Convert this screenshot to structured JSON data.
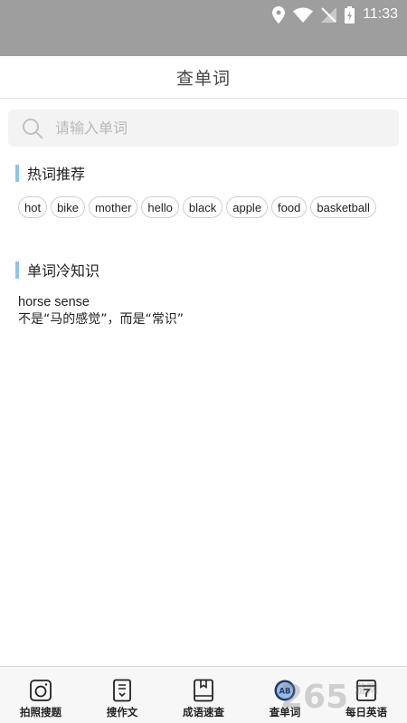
{
  "status_bar": {
    "time": "11:33"
  },
  "header": {
    "title": "查单词"
  },
  "search": {
    "placeholder": "请输入单词"
  },
  "hot_words": {
    "title": "热词推荐",
    "items": [
      "hot",
      "bike",
      "mother",
      "hello",
      "black",
      "apple",
      "food",
      "basketball"
    ]
  },
  "trivia": {
    "title": "单词冷知识",
    "phrase": "horse sense",
    "explanation": "不是“马的感觉”，而是“常识”"
  },
  "bottom_nav": {
    "items": [
      {
        "label": "拍照搜题",
        "icon": "camera-icon"
      },
      {
        "label": "搜作文",
        "icon": "document-icon"
      },
      {
        "label": "成语速查",
        "icon": "book-icon"
      },
      {
        "label": "查单词",
        "icon": "dictionary-icon"
      },
      {
        "label": "每日英语",
        "icon": "calendar-icon"
      }
    ]
  },
  "watermark": {
    "text": "265 游网"
  },
  "colors": {
    "status_bar": "#9e9e9e",
    "section_accent": "#8fc4e6",
    "nav_bg": "#f7f7f7"
  }
}
